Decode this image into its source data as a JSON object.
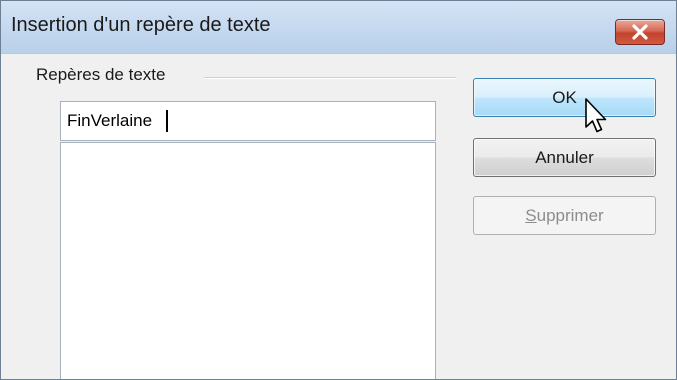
{
  "window": {
    "title": "Insertion d'un repère de texte"
  },
  "title_bar": {
    "close_icon": "close-x-icon"
  },
  "group": {
    "label": "Repères de texte"
  },
  "name_input": {
    "value": "FinVerlaine"
  },
  "bookmark_list": {
    "items": []
  },
  "buttons": {
    "ok_label": "OK",
    "cancel_label": "Annuler",
    "delete_mnemonic": "S",
    "delete_rest": "upprimer",
    "delete_enabled": false
  },
  "pointer": {
    "icon": "mouse-pointer-icon"
  },
  "colors": {
    "close_button": "#c4432e",
    "default_button_border": "#3c7fb1",
    "disabled_text": "#8d8d8d"
  }
}
